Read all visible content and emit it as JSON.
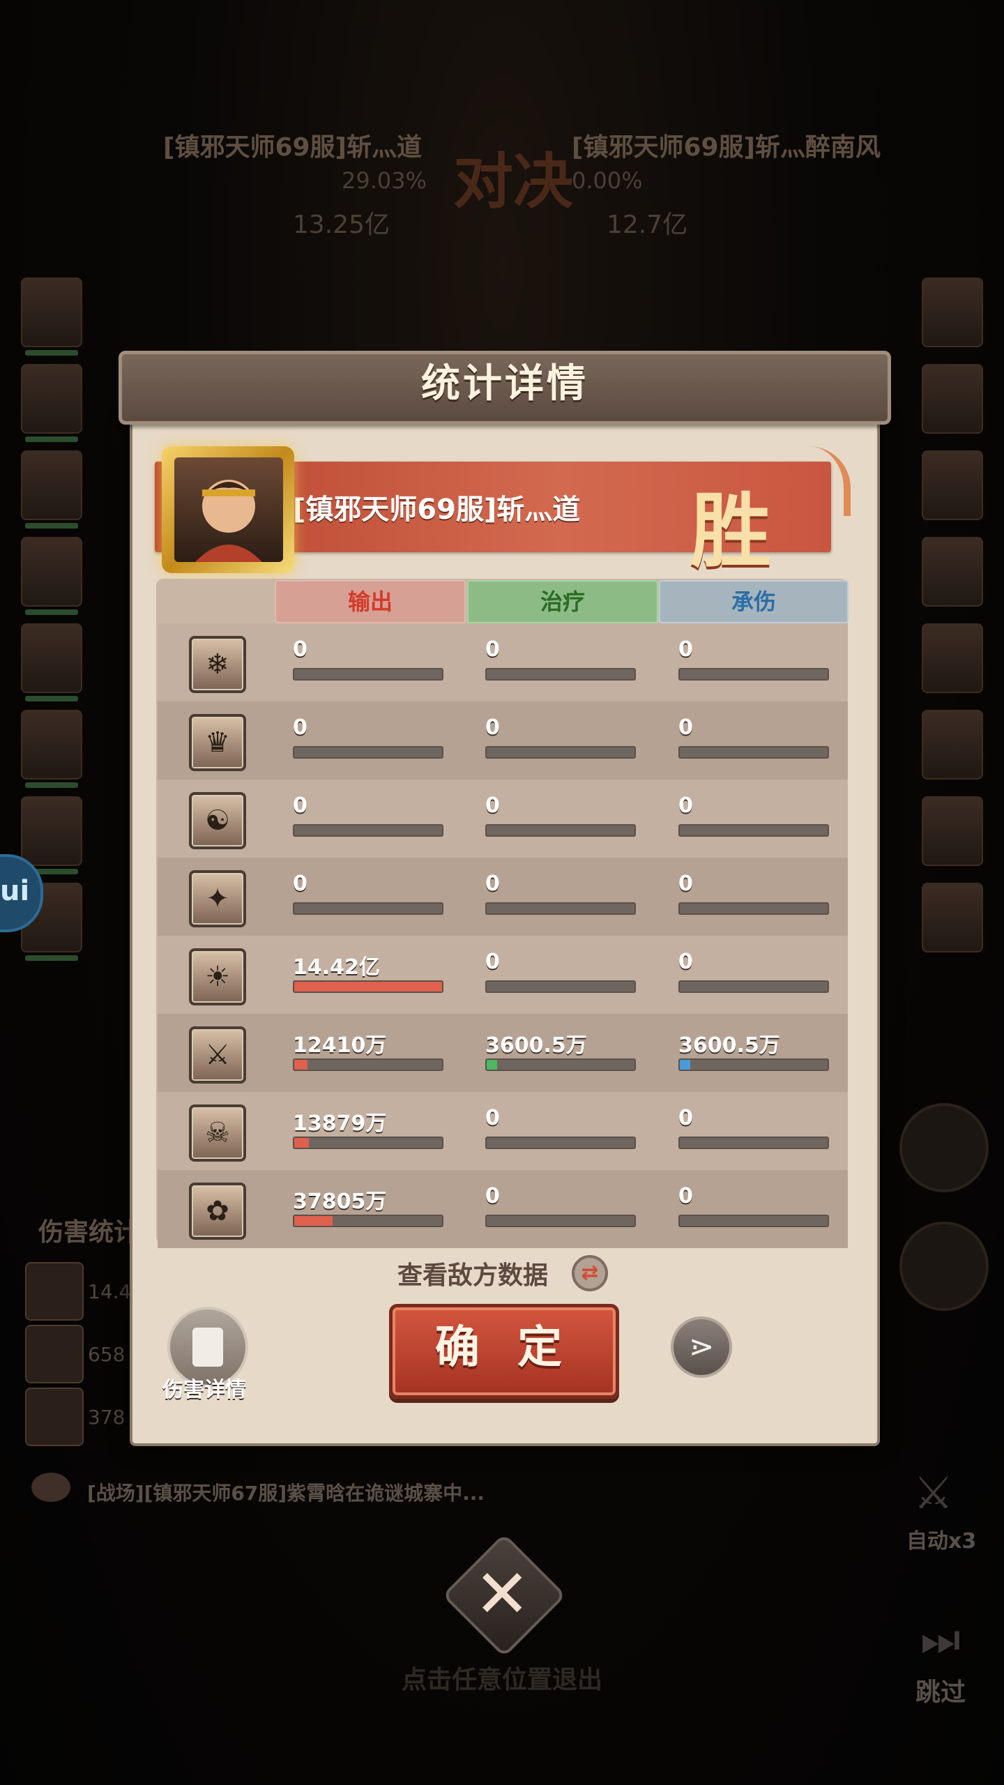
{
  "background": {
    "left_player": {
      "name": "[镇邪天师69服]斩灬道",
      "percent": "29.03%",
      "value": "13.25亿"
    },
    "right_player": {
      "name": "[镇邪天师69服]斩灬醉南风",
      "percent": "0.00%",
      "value": "12.7亿"
    },
    "vs_label": "对决",
    "damage_stats_title": "伤害统计",
    "damage_stats_values": [
      "14.4",
      "658",
      "378"
    ],
    "chat_message": "[战场][镇邪天师67服]紫霄晗在诡谜城寨中...",
    "auto_label": "自动x3",
    "skip_label": "跳过",
    "exit_hint": "点击任意位置退出",
    "side_bubble_label": "ui"
  },
  "modal": {
    "title": "统计详情",
    "player_name": "[镇邪天师69服]斩灬道",
    "result": "胜",
    "headers": {
      "output": "输出",
      "heal": "治疗",
      "tank": "承伤"
    },
    "rows": [
      {
        "icon": "ice-dragon-hero-icon",
        "output": "0",
        "heal": "0",
        "tank": "0",
        "output_pct": 0,
        "heal_pct": 0,
        "tank_pct": 0
      },
      {
        "icon": "golden-dragon-hero-icon",
        "output": "0",
        "heal": "0",
        "tank": "0",
        "output_pct": 0,
        "heal_pct": 0,
        "tank_pct": 0
      },
      {
        "icon": "panda-hero-icon",
        "output": "0",
        "heal": "0",
        "tank": "0",
        "output_pct": 0,
        "heal_pct": 0,
        "tank_pct": 0
      },
      {
        "icon": "duck-hero-icon",
        "output": "0",
        "heal": "0",
        "tank": "0",
        "output_pct": 0,
        "heal_pct": 0,
        "tank_pct": 0
      },
      {
        "icon": "monkey-king-hero-icon",
        "output": "14.42亿",
        "heal": "0",
        "tank": "0",
        "output_pct": 100,
        "heal_pct": 0,
        "tank_pct": 0
      },
      {
        "icon": "swordsman-hero-icon",
        "output": "12410万",
        "heal": "3600.5万",
        "tank": "3600.5万",
        "output_pct": 9,
        "heal_pct": 7,
        "tank_pct": 7
      },
      {
        "icon": "demon-warrior-hero-icon",
        "output": "13879万",
        "heal": "0",
        "tank": "0",
        "output_pct": 10,
        "heal_pct": 0,
        "tank_pct": 0
      },
      {
        "icon": "sorceress-hero-icon",
        "output": "37805万",
        "heal": "0",
        "tank": "0",
        "output_pct": 26,
        "heal_pct": 0,
        "tank_pct": 0
      }
    ],
    "view_enemy_label": "查看敌方数据",
    "damage_detail_label": "伤害详情",
    "confirm_label": "确 定",
    "colors": {
      "output_bar": "#e0604e",
      "heal_bar": "#4db860",
      "tank_bar": "#4a9bdc"
    }
  }
}
